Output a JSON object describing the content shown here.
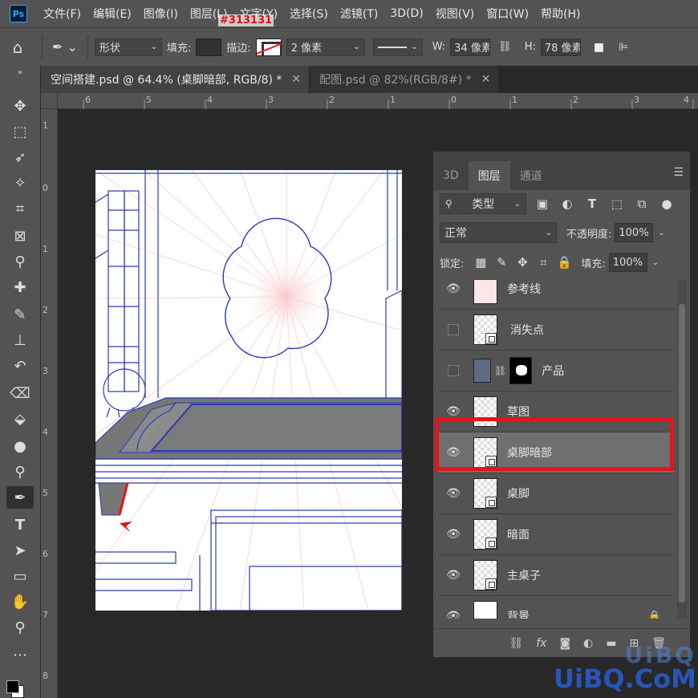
{
  "app": {
    "logo": "Ps",
    "accent": "#31a8ff"
  },
  "menubar": {
    "items": [
      "文件(F)",
      "编辑(E)",
      "图像(I)",
      "图层(L)",
      "文字(Y)",
      "选择(S)",
      "滤镜(T)",
      "3D(D)",
      "视图(V)",
      "窗口(W)",
      "帮助(H)"
    ],
    "color_annotation": "#313131"
  },
  "options": {
    "mode": "形状",
    "fill_label": "填充:",
    "fill_color": "#313131",
    "stroke_label": "描边:",
    "stroke_width": "2 像素",
    "w_label": "W:",
    "w_value": "34 像素",
    "h_label": "H:",
    "h_value": "78 像素"
  },
  "tabs": [
    {
      "label": "空间搭建.psd @ 64.4% (桌脚暗部, RGB/8) *",
      "active": true
    },
    {
      "label": "配图.psd @ 82%(RGB/8#) *",
      "active": false
    }
  ],
  "ruler": {
    "top": [
      "6",
      "5",
      "4",
      "3",
      "2",
      "1",
      "0",
      "1",
      "2",
      "3",
      "4",
      "5"
    ],
    "left": [
      "1",
      "0",
      "1",
      "2",
      "3",
      "4",
      "5",
      "6",
      "7",
      "8"
    ]
  },
  "layers_panel": {
    "tabs": [
      "3D",
      "图层",
      "通道"
    ],
    "active_tab": "图层",
    "filter_label": "类型",
    "blend_mode": "正常",
    "opacity_label": "不透明度:",
    "opacity_value": "100%",
    "lock_label": "锁定:",
    "fill_label": "填充:",
    "fill_value": "100%",
    "layers": [
      {
        "name": "参考线",
        "visible": true
      },
      {
        "name": "消失点",
        "visible": false
      },
      {
        "name": "产品",
        "visible": false
      },
      {
        "name": "草图",
        "visible": true
      },
      {
        "name": "桌脚暗部",
        "visible": true,
        "selected": true
      },
      {
        "name": "桌脚",
        "visible": true
      },
      {
        "name": "暗面",
        "visible": true
      },
      {
        "name": "主桌子",
        "visible": true
      },
      {
        "name": "背景",
        "visible": true,
        "locked": true
      }
    ],
    "highlight_color": "#e1151a"
  },
  "watermark": {
    "cn": "UiBQ",
    "en": "UiBQ.CoM"
  }
}
